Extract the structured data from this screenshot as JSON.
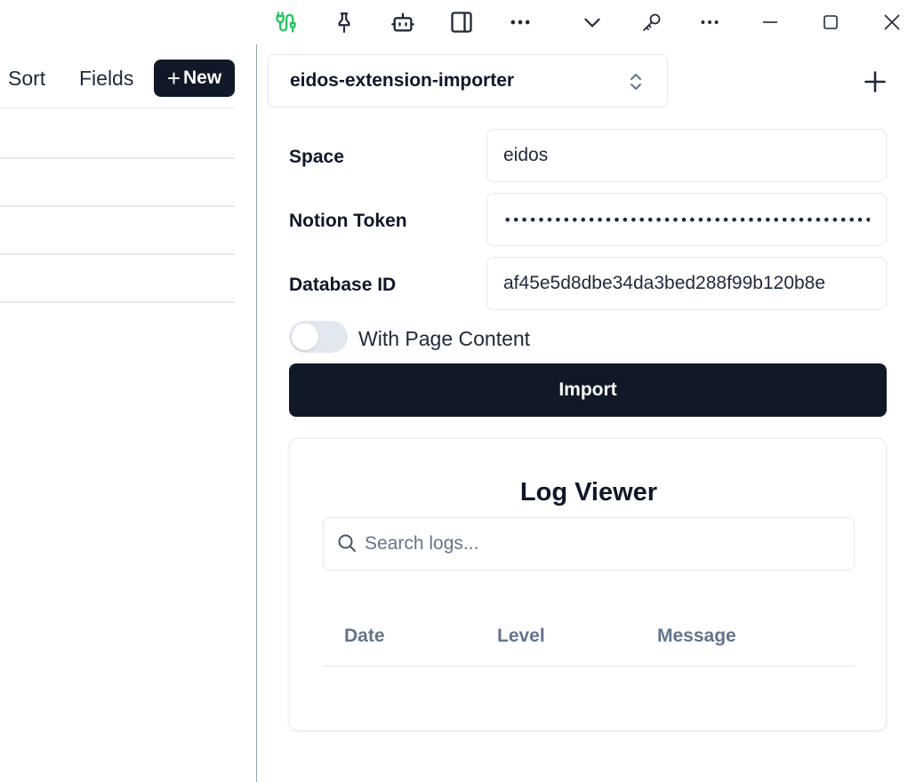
{
  "titlebar": {
    "icons": [
      "route-plug-icon",
      "pin-icon",
      "bot-icon",
      "panel-right-icon",
      "more-horizontal-icon",
      "chevron-down-icon",
      "key-icon",
      "more-horizontal-icon",
      "minimize-icon",
      "maximize-icon",
      "close-icon"
    ],
    "accent_color": "#22c55e"
  },
  "left": {
    "sort_label": "Sort",
    "fields_label": "Fields",
    "new_label": "New"
  },
  "importer": {
    "selected_extension": "eidos-extension-importer",
    "space_label": "Space",
    "space_value": "eidos",
    "token_label": "Notion Token",
    "token_value": "••••••••••••••••••••••••••••••••••••••••••••••••••",
    "database_label": "Database ID",
    "database_value": "af45e5d8dbe34da3bed288f99b120b8e",
    "page_content_label": "With Page Content",
    "page_content_enabled": false,
    "import_label": "Import"
  },
  "log_viewer": {
    "title": "Log Viewer",
    "search_placeholder": "Search logs...",
    "columns": [
      "Date",
      "Level",
      "Message"
    ]
  },
  "colors": {
    "primary_dark": "#111827",
    "border": "#e2e8f0",
    "muted_text": "#64748b"
  }
}
